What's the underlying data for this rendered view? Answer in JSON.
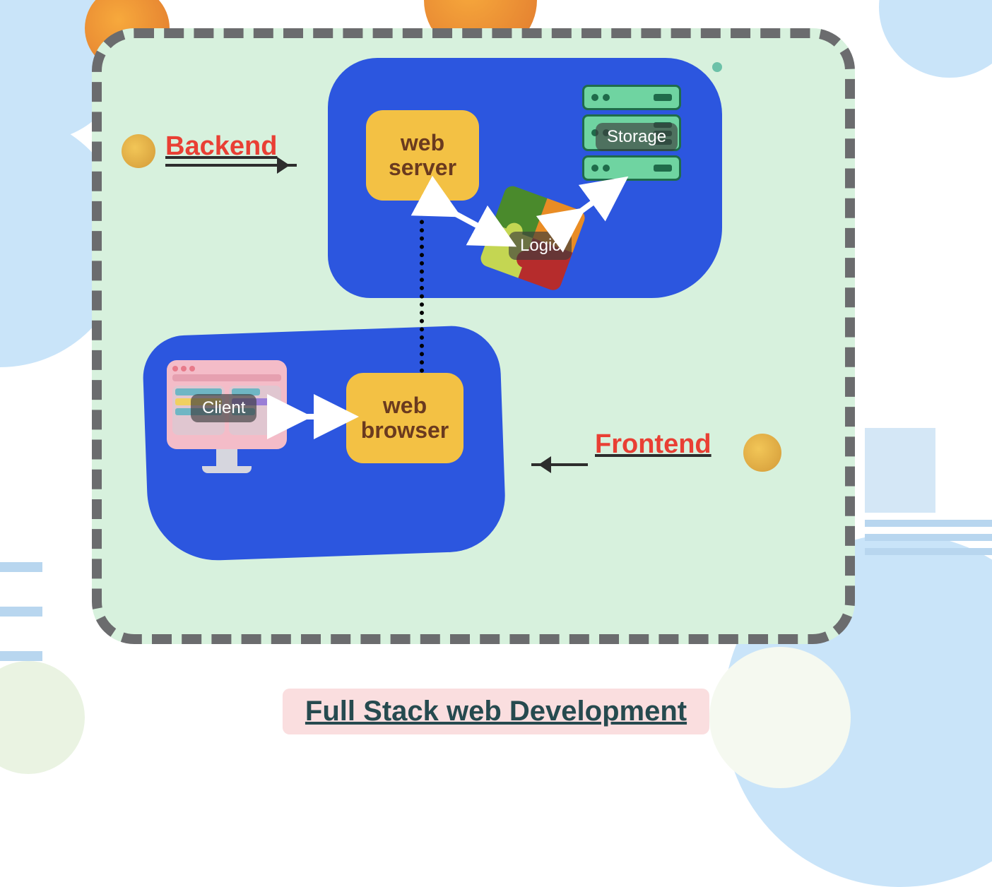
{
  "title": "Full Stack web Development",
  "sections": {
    "backend": {
      "label": "Backend"
    },
    "frontend": {
      "label": "Frontend"
    }
  },
  "nodes": {
    "web_server": "web server",
    "web_browser": "web browser",
    "storage": "Storage",
    "logic": "Logic",
    "client": "Client"
  }
}
